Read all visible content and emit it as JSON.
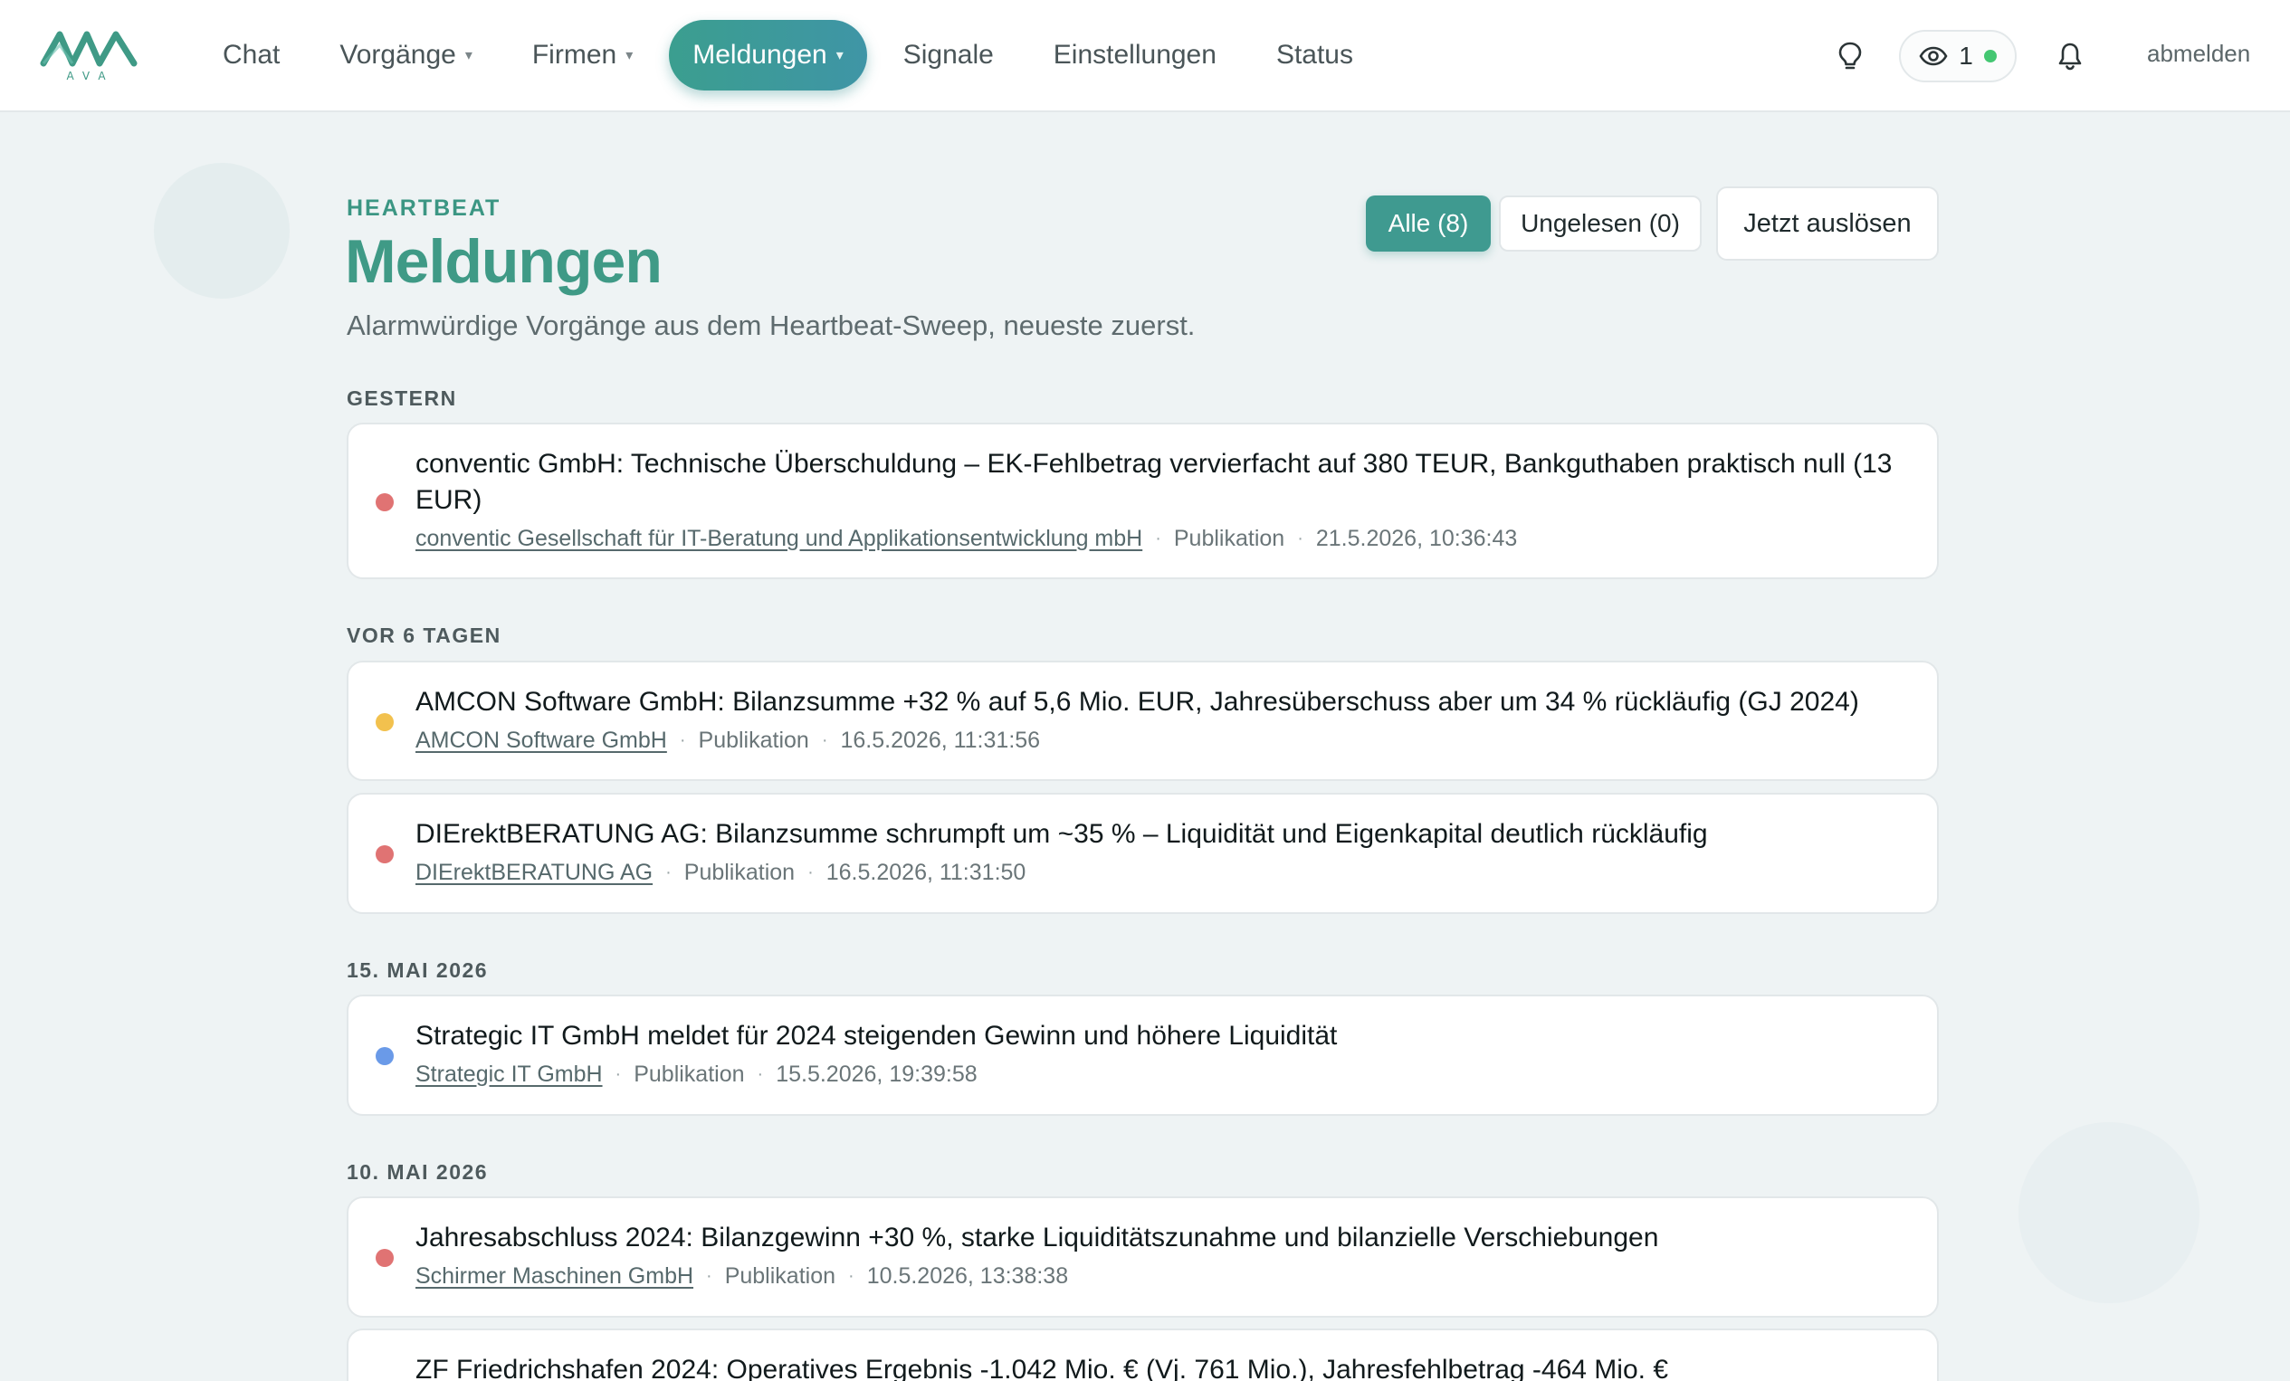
{
  "brand": {
    "logo_text": "AVA",
    "accent": "#3f9a86"
  },
  "nav": {
    "items": [
      {
        "label": "Chat",
        "has_caret": false
      },
      {
        "label": "Vorgänge",
        "has_caret": true
      },
      {
        "label": "Firmen",
        "has_caret": true
      },
      {
        "label": "Meldungen",
        "has_caret": true,
        "active": true
      },
      {
        "label": "Signale",
        "has_caret": false
      },
      {
        "label": "Einstellungen",
        "has_caret": false
      },
      {
        "label": "Status",
        "has_caret": false
      }
    ],
    "caret": "▾",
    "watch_count": "1",
    "logout": "abmelden"
  },
  "header": {
    "eyebrow": "HEARTBEAT",
    "title": "Meldungen",
    "subtitle": "Alarmwürdige Vorgänge aus dem Heartbeat-Sweep, neueste zuerst.",
    "filter_all": "Alle (8)",
    "filter_unread": "Ungelesen (0)",
    "trigger": "Jetzt auslösen"
  },
  "severity_colors": {
    "red": "#e07373",
    "yellow": "#f2c14e",
    "blue": "#6a9ae8"
  },
  "groups": [
    {
      "label": "GESTERN",
      "items": [
        {
          "severity": "red",
          "title": "conventic GmbH: Technische Überschuldung – EK-Fehlbetrag vervierfacht auf 380 TEUR, Bankguthaben praktisch null (13 EUR)",
          "company": "conventic Gesellschaft für IT-Beratung und Applikationsentwicklung mbH",
          "source": "Publikation",
          "timestamp": "21.5.2026, 10:36:43"
        }
      ]
    },
    {
      "label": "VOR 6 TAGEN",
      "items": [
        {
          "severity": "yellow",
          "title": "AMCON Software GmbH: Bilanzsumme +32 % auf 5,6 Mio. EUR, Jahresüberschuss aber um 34 % rückläufig (GJ 2024)",
          "company": "AMCON Software GmbH",
          "source": "Publikation",
          "timestamp": "16.5.2026, 11:31:56"
        },
        {
          "severity": "red",
          "title": "DIErektBERATUNG AG: Bilanzsumme schrumpft um ~35 % – Liquidität und Eigenkapital deutlich rückläufig",
          "company": "DIErektBERATUNG AG",
          "source": "Publikation",
          "timestamp": "16.5.2026, 11:31:50"
        }
      ]
    },
    {
      "label": "15. MAI 2026",
      "items": [
        {
          "severity": "blue",
          "title": "Strategic IT GmbH meldet für 2024 steigenden Gewinn und höhere Liquidität",
          "company": "Strategic IT GmbH",
          "source": "Publikation",
          "timestamp": "15.5.2026, 19:39:58"
        }
      ]
    },
    {
      "label": "10. MAI 2026",
      "items": [
        {
          "severity": "red",
          "title": "Jahresabschluss 2024: Bilanzgewinn +30 %, starke Liquiditätszunahme und bilanzielle Verschiebungen",
          "company": "Schirmer Maschinen GmbH",
          "source": "Publikation",
          "timestamp": "10.5.2026, 13:38:38"
        },
        {
          "severity": "red",
          "title": "ZF Friedrichshafen 2024: Operatives Ergebnis -1.042 Mio. € (Vj. 761 Mio.), Jahresfehlbetrag -464 Mio. €"
        }
      ]
    }
  ]
}
